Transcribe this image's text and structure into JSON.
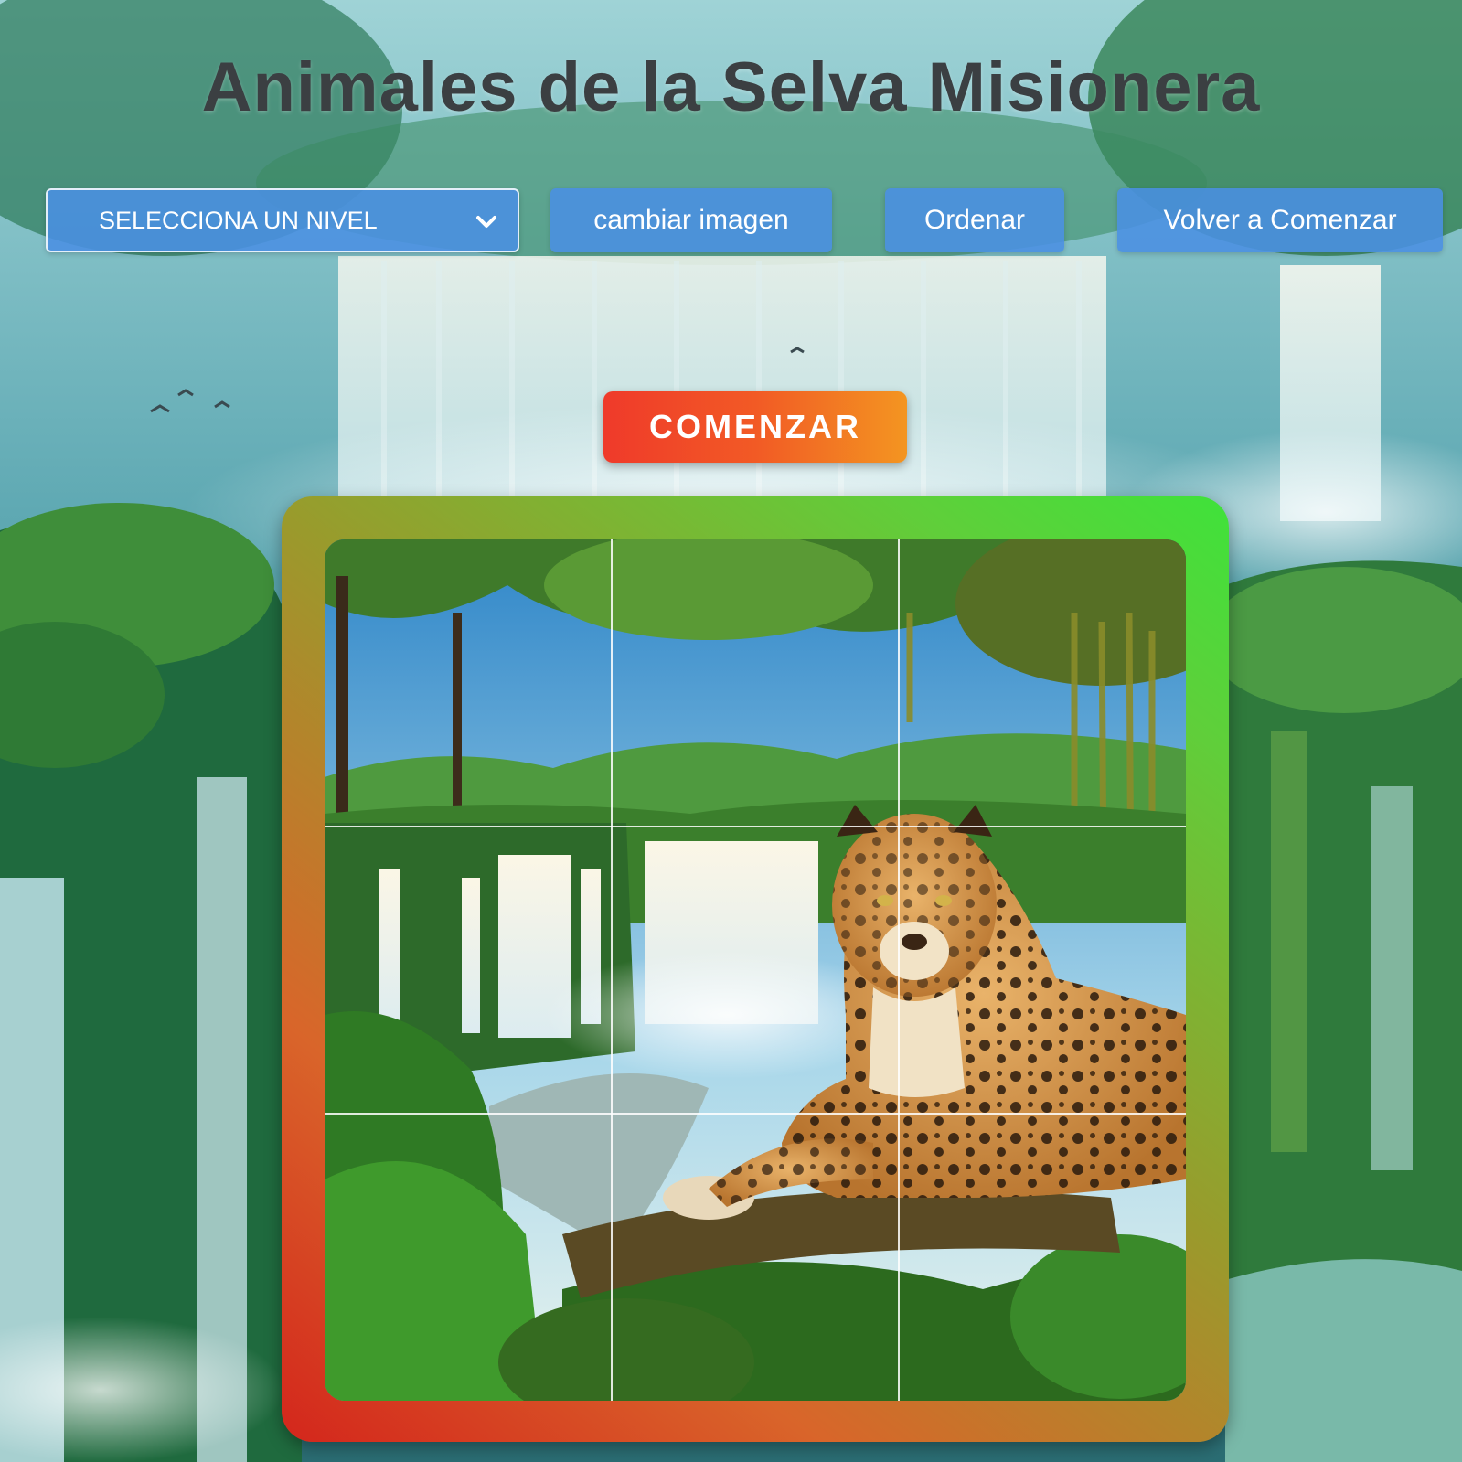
{
  "title": "Animales de la Selva Misionera",
  "toolbar": {
    "level_select": {
      "selected": "SELECCIONA UN NIVEL",
      "icon": "chevron-down-icon"
    },
    "change_image_label": "cambiar imagen",
    "sort_label": "Ordenar",
    "restart_label": "Volver a Comenzar"
  },
  "start_button": {
    "label": "COMENZAR"
  },
  "puzzle": {
    "rows": 3,
    "cols": 3,
    "image": "jaguar-waterfall-jungle",
    "tiles": [
      {
        "index": 1,
        "name": "tile-1"
      },
      {
        "index": 2,
        "name": "tile-2"
      },
      {
        "index": 3,
        "name": "tile-3"
      },
      {
        "index": 4,
        "name": "tile-4"
      },
      {
        "index": 5,
        "name": "tile-5"
      },
      {
        "index": 6,
        "name": "tile-6"
      },
      {
        "index": 7,
        "name": "tile-7"
      },
      {
        "index": 8,
        "name": "tile-8"
      },
      {
        "index": 9,
        "name": "tile-9"
      }
    ]
  },
  "colors": {
    "button_blue": "#4a90e2",
    "start_gradient": [
      "#ef3a2a",
      "#f39521"
    ],
    "frame_gradient": [
      "#d4261c",
      "#3fe23a"
    ],
    "title_color": "#3b3f42"
  }
}
